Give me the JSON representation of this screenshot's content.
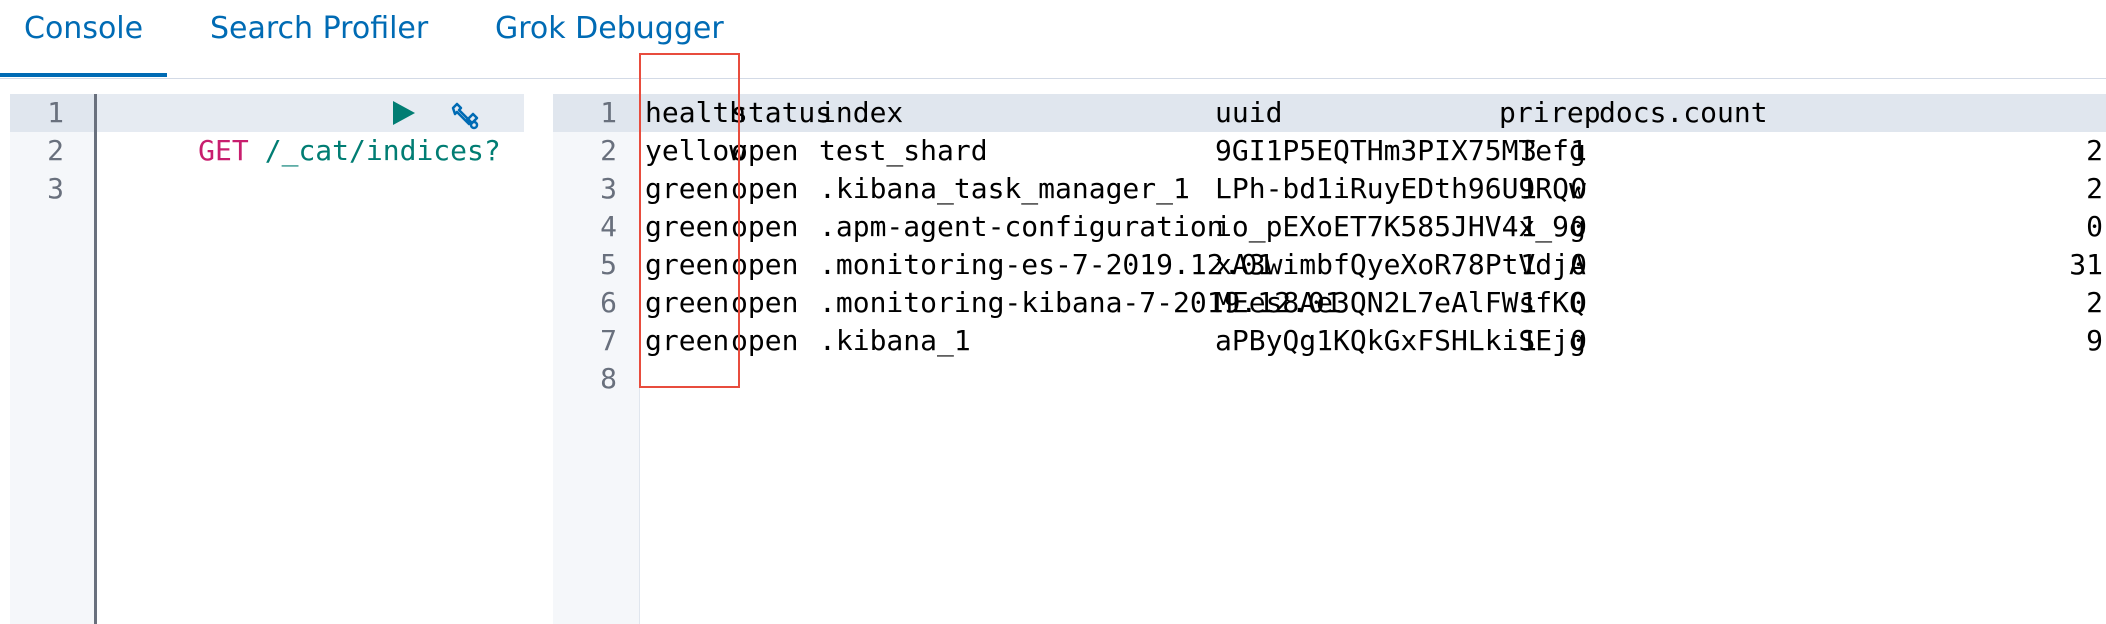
{
  "tabs": [
    {
      "label": "Console",
      "active": true
    },
    {
      "label": "Search Profiler",
      "active": false
    },
    {
      "label": "Grok Debugger",
      "active": false
    }
  ],
  "request": {
    "line_numbers": [
      "1",
      "2",
      "3"
    ],
    "method": "GET",
    "path": "/_cat/indices?"
  },
  "response": {
    "line_numbers": [
      "1",
      "2",
      "3",
      "4",
      "5",
      "6",
      "7",
      "8"
    ],
    "header": {
      "health": "health",
      "status": "status",
      "index": "index",
      "uuid": "uuid",
      "pri": "pri",
      "rep": "rep",
      "docs_count": "docs.count"
    },
    "rows": [
      {
        "health": "yellow",
        "status": "open",
        "index": "test_shard",
        "uuid": "9GI1P5EQTHm3PIX75MTefg",
        "pri": "3",
        "rep": "1",
        "docs_count": "2"
      },
      {
        "health": "green",
        "status": "open",
        "index": ".kibana_task_manager_1",
        "uuid": "LPh-bd1iRuyEDth96U9RQw",
        "pri": "1",
        "rep": "0",
        "docs_count": "2"
      },
      {
        "health": "green",
        "status": "open",
        "index": ".apm-agent-configuration",
        "uuid": "io_pEXoET7K585JHV4x_9g",
        "pri": "1",
        "rep": "0",
        "docs_count": "0"
      },
      {
        "health": "green",
        "status": "open",
        "index": ".monitoring-es-7-2019.12.01",
        "uuid": "xA3wimbfQyeXoR78PtVdjA",
        "pri": "1",
        "rep": "0",
        "docs_count": "31"
      },
      {
        "health": "green",
        "status": "open",
        "index": ".monitoring-kibana-7-2019.12.01",
        "uuid": "MEes8Ae3QN2L7eAlFWsfKQ",
        "pri": "1",
        "rep": "0",
        "docs_count": "2"
      },
      {
        "health": "green",
        "status": "open",
        "index": ".kibana_1",
        "uuid": "aPByQg1KQkGxFSHLkiSEjg",
        "pri": "1",
        "rep": "0",
        "docs_count": "9"
      }
    ]
  },
  "icons": {
    "run": "play-icon",
    "settings": "wrench-icon"
  },
  "colors": {
    "accent": "#006bb4",
    "method": "#c81e6e",
    "url": "#017d73",
    "annotation": "#e84c3d"
  }
}
